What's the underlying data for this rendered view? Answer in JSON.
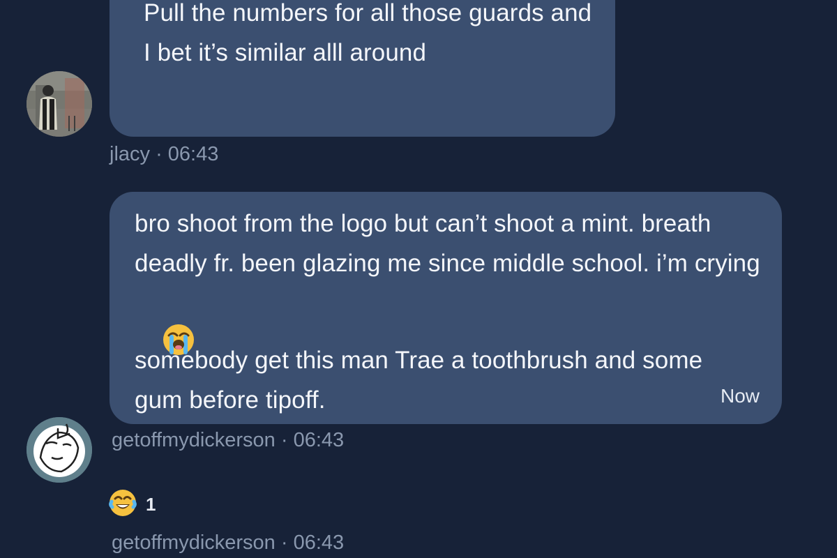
{
  "messages": [
    {
      "text": "Pull the numbers for all those guards and I bet it’s similar alll around"
    },
    {
      "text_line_1": "bro shoot from the logo but can’t shoot a mint. breath deadly fr. been glazing me since middle school. i’m crying",
      "text_line_2": "somebody get this man Trae a toothbrush and some gum before tipoff.",
      "time": "Now"
    }
  ],
  "meta": {
    "first": "jlacy · 06:43",
    "second": "getoffmydickerson · 06:43",
    "third": "getoffmydickerson · 06:43"
  },
  "reaction": {
    "count": "1",
    "icon": "laughing-crying-emoji"
  },
  "icons": {
    "crying_emoji": "loudly-crying-emoji",
    "laugh_emoji": "laughing-crying-emoji"
  },
  "colors": {
    "background": "#172238",
    "bubble": "#3b4f70",
    "meta_text": "#8a98ae",
    "message_text": "#f4f6fa"
  }
}
